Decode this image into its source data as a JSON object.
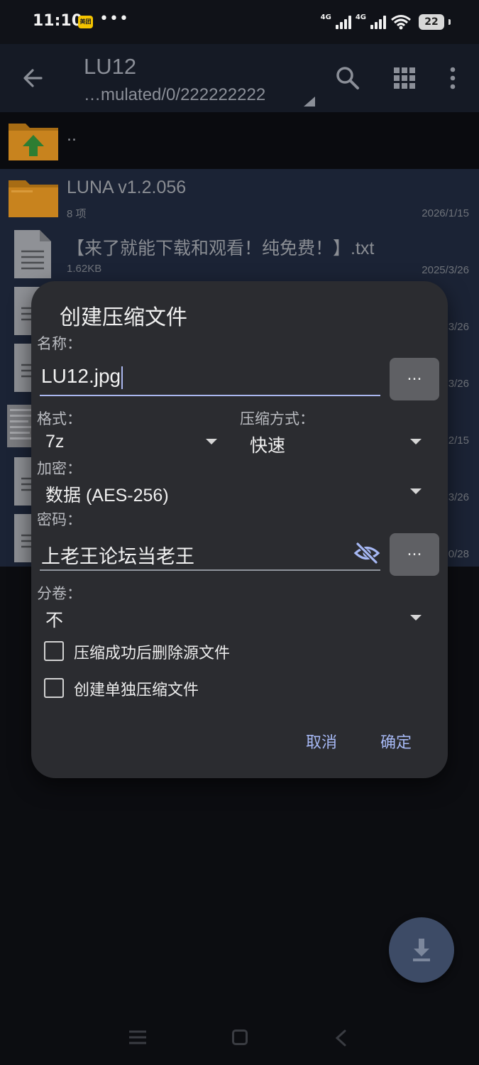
{
  "status": {
    "time": "11:10",
    "badge": "美团",
    "dots": "•••",
    "net1": "4G",
    "net2": "4G",
    "battery": "22"
  },
  "toolbar": {
    "title": "LU12",
    "path": "…mulated/0/222222222"
  },
  "files": [
    {
      "name": "..",
      "type": "up"
    },
    {
      "name": "LUNA v1.2.056",
      "meta": "8 项",
      "date": "2026/1/15",
      "type": "folder"
    },
    {
      "name": "【来了就能下载和观看！纯免费！】.txt",
      "meta": "1.62KB",
      "date": "2025/3/26",
      "type": "doc"
    }
  ],
  "hidden_dates": [
    "3/26",
    "3/26",
    "2/15",
    "3/26",
    "0/28"
  ],
  "dialog": {
    "title": "创建压缩文件",
    "name_label": "名称：",
    "name_value": "LU12.jpg",
    "dots": "...",
    "format_label": "格式：",
    "format_value": "7z",
    "method_label": "压缩方式：",
    "method_value": "快速",
    "encrypt_label": "加密：",
    "encrypt_value": "数据 (AES-256)",
    "password_label": "密码：",
    "password_value": "上老王论坛当老王",
    "volume_label": "分卷：",
    "volume_value": "不",
    "delete_source": "压缩成功后删除源文件",
    "separate_archive": "创建单独压缩文件",
    "cancel": "取消",
    "ok": "确定"
  },
  "colors": {
    "accent": "#a6b8f4",
    "dialog_bg": "#2b2c30",
    "folder": "#c8831e",
    "selection": "#1b2335"
  },
  "icons": [
    "back-arrow-icon",
    "search-icon",
    "grid-view-icon",
    "more-vert-icon",
    "folder-icon",
    "folder-up-icon",
    "text-file-icon",
    "visibility-off-icon",
    "download-icon"
  ]
}
